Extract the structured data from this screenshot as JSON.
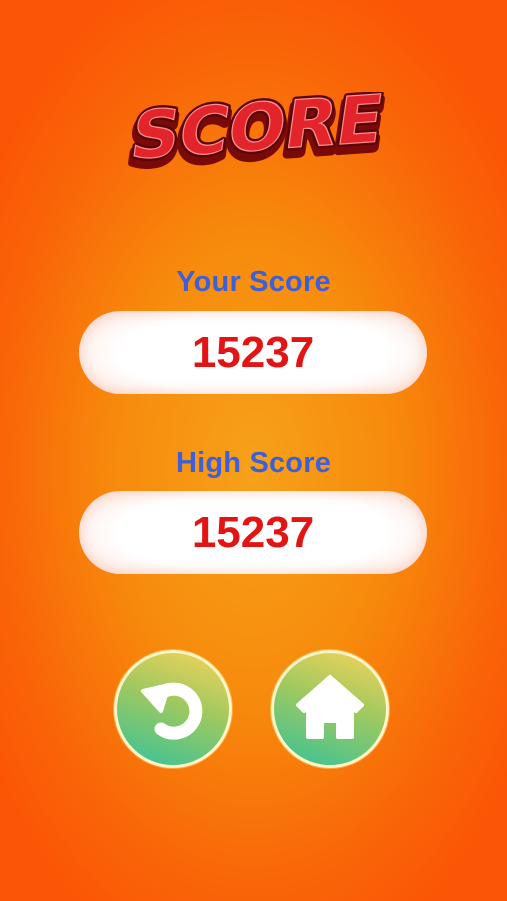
{
  "title": "SCORE",
  "your_score": {
    "label": "Your Score",
    "value": "15237"
  },
  "high_score": {
    "label": "High Score",
    "value": "15237"
  },
  "buttons": {
    "replay_icon": "replay-arrow-icon",
    "home_icon": "home-icon"
  },
  "colors": {
    "background": "#f78a0c",
    "title_red": "#e3242b",
    "label_blue": "#3f5fd8",
    "value_red": "#e31414",
    "button_gradient_top": "#f7d35a",
    "button_gradient_bottom": "#35c29a"
  }
}
